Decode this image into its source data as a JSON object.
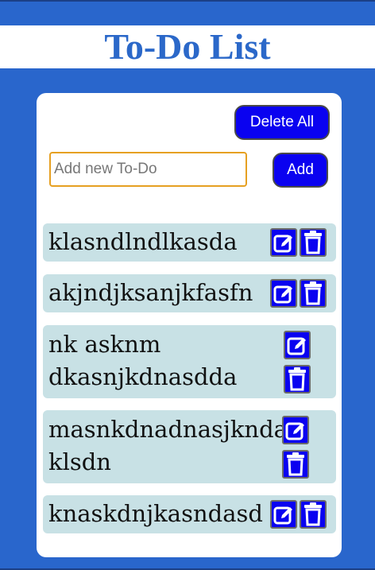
{
  "app": {
    "title": "To-Do List"
  },
  "toolbar": {
    "delete_all_label": "Delete All",
    "add_label": "Add"
  },
  "new_todo": {
    "value": "",
    "placeholder": "Add new To-Do"
  },
  "todos": [
    {
      "text": "klasndlndlkasda"
    },
    {
      "text": "akjndjksanjkfasfn"
    },
    {
      "text": "nk asknm dkasnjkdnasdda"
    },
    {
      "text": "masnkdnadnasjknda klsdn"
    },
    {
      "text": "knaskdnjkasndasd"
    }
  ],
  "icons": {
    "edit": "edit-icon",
    "delete": "trash-icon"
  },
  "colors": {
    "page_background": "#2966cc",
    "title": "#2b68c9",
    "button": "#0a02f0",
    "item_background": "#c8e1e5",
    "input_border": "#e6a021"
  }
}
